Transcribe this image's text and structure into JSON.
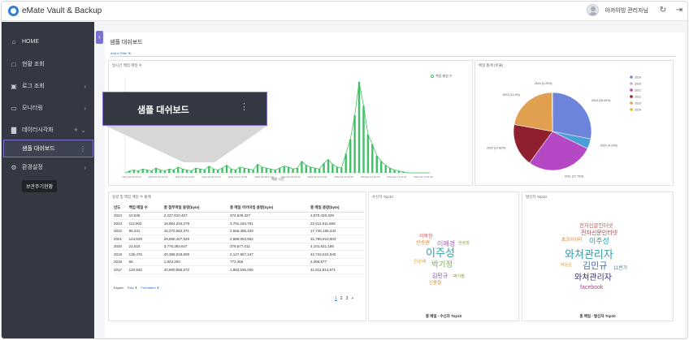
{
  "app": {
    "title": "eMate Vault & Backup",
    "user": "아카이빙 관리자님"
  },
  "sidebar": {
    "items": [
      {
        "label": "HOME",
        "icon": "home-icon"
      },
      {
        "label": "현황 조회",
        "icon": "monitor-icon"
      },
      {
        "label": "로그 조회",
        "icon": "log-icon"
      },
      {
        "label": "모니터링",
        "icon": "display-icon"
      },
      {
        "label": "데이터시각화",
        "icon": "bar-chart-icon"
      },
      {
        "label": "환경설정",
        "icon": "gear-icon"
      }
    ],
    "active_sub": "샘플 대쉬보드",
    "tooltip": "보관주기현황"
  },
  "dashboard": {
    "title": "샘플 대쉬보드",
    "add_filter": "Add a Filter ⊕",
    "popup_title": "샘플 대쉬보드"
  },
  "line_panel": {
    "title": "일시간 백업 메일 수",
    "legend": "백업 메일 수",
    "xlabel": "메일 시간"
  },
  "pie_panel": {
    "title": "메일 통계 (비율)"
  },
  "table_panel": {
    "title": "용량 및 백업 메일 수 통계",
    "columns": [
      "년도",
      "백업 메일 수",
      "총 첨부파일 용량(byte)",
      "총 메일 아카이빙 용량(byte)",
      "총 메일 용량(byte)"
    ],
    "rows": [
      [
        "2024",
        "10,636",
        "2,227,810,457",
        "372,539,327",
        "2,570,420,329"
      ],
      [
        "2023",
        "112,902",
        "18,964,334,279",
        "3,791,164,781",
        "22,511,611,669"
      ],
      [
        "2022",
        "95,341",
        "15,270,662,371",
        "2,556,366,420",
        "17,746,155,442"
      ],
      [
        "2021",
        "144,629",
        "29,858,407,929",
        "2,889,904,552",
        "31,789,810,603"
      ],
      [
        "2020",
        "21,615",
        "3,776,383,647",
        "379,577,011",
        "4,101,831,185"
      ],
      [
        "2019",
        "136,476",
        "40,358,018,609",
        "2,147,957,247",
        "42,744,624,940"
      ],
      [
        "2018",
        "65",
        "1,823,293",
        "773,466",
        "2,366,577"
      ],
      [
        "2017",
        "120,842",
        "40,800,855,572",
        "1,862,536,026",
        "41,811,814,871"
      ]
    ],
    "export_label": "Export:",
    "export_raw": "Raw ⬇",
    "export_formatted": "Formatted ⬇",
    "pages": [
      "1",
      "2",
      "3",
      "»"
    ]
  },
  "receiver_cloud": {
    "title": "수신자 Top10",
    "footer": "총 메일 - 수신자 Top10",
    "words": [
      {
        "text": "이북헌",
        "color": "#d0504e"
      },
      {
        "text": "신승권",
        "color": "#d87a2a"
      },
      {
        "text": "이예경",
        "color": "#a85fc7"
      },
      {
        "text": "한정철",
        "color": "#8aa640"
      },
      {
        "text": "이주성",
        "color": "#2f9fa7"
      },
      {
        "text": "전순배",
        "color": "#d6a733"
      },
      {
        "text": "박기정",
        "color": "#71b34b"
      },
      {
        "text": "김민규",
        "color": "#7e52b3"
      },
      {
        "text": "박기정",
        "color": "#8a8a3a"
      },
      {
        "text": "신용철",
        "color": "#c9932e"
      }
    ]
  },
  "sender_cloud": {
    "title": "발신자 Top10",
    "footer": "총 메일 - 발신자 Top10",
    "words": [
      {
        "text": "전자신문인터넷",
        "color": "#d0504e"
      },
      {
        "text": "전자신문인터넷",
        "color": "#a34b4b"
      },
      {
        "text": "호크아이티",
        "color": "#d87a2a"
      },
      {
        "text": "이주성",
        "color": "#2f9fa7"
      },
      {
        "text": "와쳐관리자",
        "color": "#2f9fa7"
      },
      {
        "text": "박윤순",
        "color": "#d6a733"
      },
      {
        "text": "김민규",
        "color": "#3d6fb5"
      },
      {
        "text": "11번가",
        "color": "#3a8a9a"
      },
      {
        "text": "와쳐관리자",
        "color": "#3b2f6b"
      },
      {
        "text": "facebook",
        "color": "#a84f8a"
      }
    ]
  },
  "chart_data": [
    {
      "type": "line",
      "title": "일시간 백업 메일 수",
      "xlabel": "메일 시간",
      "series": [
        {
          "name": "백업 메일 수",
          "values": [
            0,
            2,
            3,
            2,
            4,
            3,
            2,
            5,
            3,
            2,
            4,
            3,
            6,
            4,
            3,
            2,
            5,
            4,
            3,
            7,
            4,
            3,
            5,
            8,
            4,
            3,
            6,
            5,
            4,
            3,
            9,
            6,
            5,
            4,
            3,
            5,
            7,
            6,
            4,
            5,
            12,
            8,
            6,
            5,
            4,
            10,
            14,
            9,
            6,
            5,
            20,
            35,
            60,
            95,
            70,
            40,
            30,
            18,
            12,
            8,
            5,
            3,
            2,
            1,
            0,
            0,
            0,
            0,
            0,
            0
          ]
        }
      ],
      "x_ticks": [
        "2024-02-02 01:00",
        "2024-02-04 01:00",
        "2024-02-05 01:00",
        "2024-02-06 01:00",
        "2024-02-07 01:00",
        "2024-02-08 01:00",
        "2024-02-09 01:00",
        "2024-02-10 01:00",
        "2024-02-11 01:00",
        "2024-02-12 01:00",
        "2024-02-13 01:00",
        "2024-02-14 01:00"
      ]
    },
    {
      "type": "pie",
      "title": "메일 통계 (비율)",
      "categories": [
        "2019",
        "2020",
        "2021",
        "2022",
        "2023",
        "2024"
      ],
      "values": [
        28.09,
        4.19,
        27.75,
        17.82,
        21.9,
        0.25
      ],
      "labels": [
        "2019 (28.09%)",
        "2020 (4.19%)",
        "2021 (27.75%)",
        "2022 (17.82%)",
        "2023 (21.9%)",
        "2024 (0.25%)"
      ],
      "colors": [
        "#6c84d9",
        "#4a9fd8",
        "#b548c4",
        "#8f1f2e",
        "#e0a050",
        "#d9c02a"
      ],
      "legend": [
        "2019",
        "2020",
        "2021",
        "2022",
        "2023",
        "2024"
      ],
      "legend_colors": [
        "#6c84d9",
        "#c9a8e0",
        "#b548c4",
        "#8f1f2e",
        "#e0a050",
        "#d9c02a"
      ]
    }
  ]
}
